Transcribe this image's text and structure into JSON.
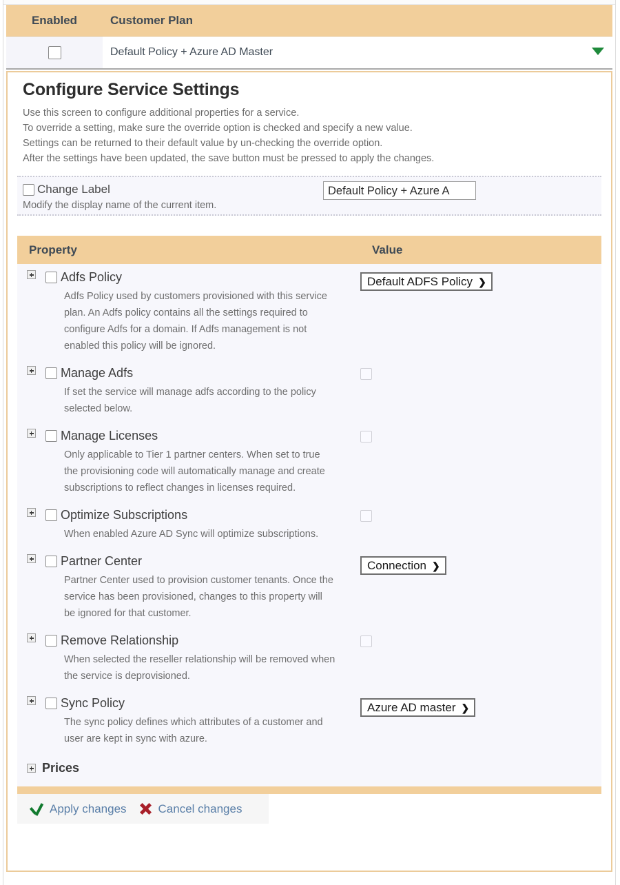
{
  "plan_grid": {
    "headers": {
      "enabled": "Enabled",
      "customer_plan": "Customer Plan"
    },
    "row": {
      "plan_name": "Default Policy + Azure AD Master",
      "enabled": false,
      "caret": "caret-down-icon"
    }
  },
  "panel": {
    "title": "Configure Service Settings",
    "intro": [
      "Use this screen to configure additional properties for a service.",
      "To override a setting, make sure the override option is checked and specify a new value.",
      "Settings can be returned to their default value by un-checking the override option.",
      "After the settings have been updated, the save button must be pressed to apply the changes."
    ],
    "change_label": {
      "label": "Change Label",
      "checked": false,
      "value": "Default Policy + Azure A",
      "hint": "Modify the display name of the current item."
    }
  },
  "property_table": {
    "headers": {
      "property": "Property",
      "value": "Value"
    },
    "rows": [
      {
        "name": "Adfs Policy",
        "override_checked": false,
        "desc": [
          "Adfs Policy used by customers provisioned with this service",
          "plan. An Adfs policy contains all the settings required to",
          "configure Adfs for a domain. If Adfs management is not",
          "enabled this policy will be ignored."
        ],
        "value_type": "select",
        "value": "Default ADFS Policy"
      },
      {
        "name": "Manage Adfs",
        "override_checked": false,
        "desc": [
          "If set the service will manage adfs according to the policy",
          "selected below."
        ],
        "value_type": "checkbox",
        "value_checked": false
      },
      {
        "name": "Manage Licenses",
        "override_checked": false,
        "desc": [
          "Only applicable to Tier 1 partner centers. When set to true",
          "the provisioning code will automatically manage and create",
          "subscriptions to reflect changes in licenses required."
        ],
        "value_type": "checkbox",
        "value_checked": false
      },
      {
        "name": "Optimize Subscriptions",
        "override_checked": false,
        "desc": [
          "When enabled Azure AD Sync will optimize subscriptions."
        ],
        "value_type": "checkbox",
        "value_checked": false
      },
      {
        "name": "Partner Center",
        "override_checked": false,
        "desc": [
          "Partner Center used to provision customer tenants. Once the",
          "service has been provisioned, changes to this property will",
          "be ignored for that customer."
        ],
        "value_type": "select",
        "value": "Connection"
      },
      {
        "name": "Remove Relationship",
        "override_checked": false,
        "desc": [
          "When selected the reseller relationship will be removed when",
          "the service is deprovisioned."
        ],
        "value_type": "checkbox",
        "value_checked": false
      },
      {
        "name": "Sync Policy",
        "override_checked": false,
        "desc": [
          "The sync policy defines which attributes of a customer and",
          "user are kept in sync with azure."
        ],
        "value_type": "select",
        "value": "Azure AD master"
      }
    ],
    "prices_group": {
      "label": "Prices",
      "expanded": false
    }
  },
  "footer": {
    "apply": {
      "label": "Apply changes",
      "icon": "check-icon"
    },
    "cancel": {
      "label": "Cancel changes",
      "icon": "cross-icon"
    }
  },
  "colors": {
    "header_tan": "#f2cf9b",
    "panel_border": "#eccb9a",
    "row_bg": "#f7f7fc",
    "link_blue": "#5a7fa8",
    "check_green": "#117a2e",
    "cross_red": "#a81f29",
    "caret_green": "#1f8a3b"
  }
}
